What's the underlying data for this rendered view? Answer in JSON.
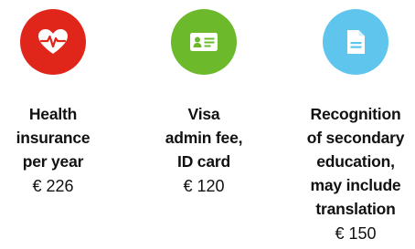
{
  "items": [
    {
      "icon": "heart-pulse-icon",
      "color": "#e0261b",
      "label_lines": [
        "Health",
        "insurance",
        "per year"
      ],
      "price": "€ 226"
    },
    {
      "icon": "id-card-icon",
      "color": "#6cba2c",
      "label_lines": [
        "Visa",
        "admin fee,",
        "ID card"
      ],
      "price": "€ 120"
    },
    {
      "icon": "document-icon",
      "color": "#5fc5ec",
      "label_lines": [
        "Recognition",
        "of secondary",
        "education,",
        "may include",
        "translation"
      ],
      "price": "€ 150"
    }
  ]
}
